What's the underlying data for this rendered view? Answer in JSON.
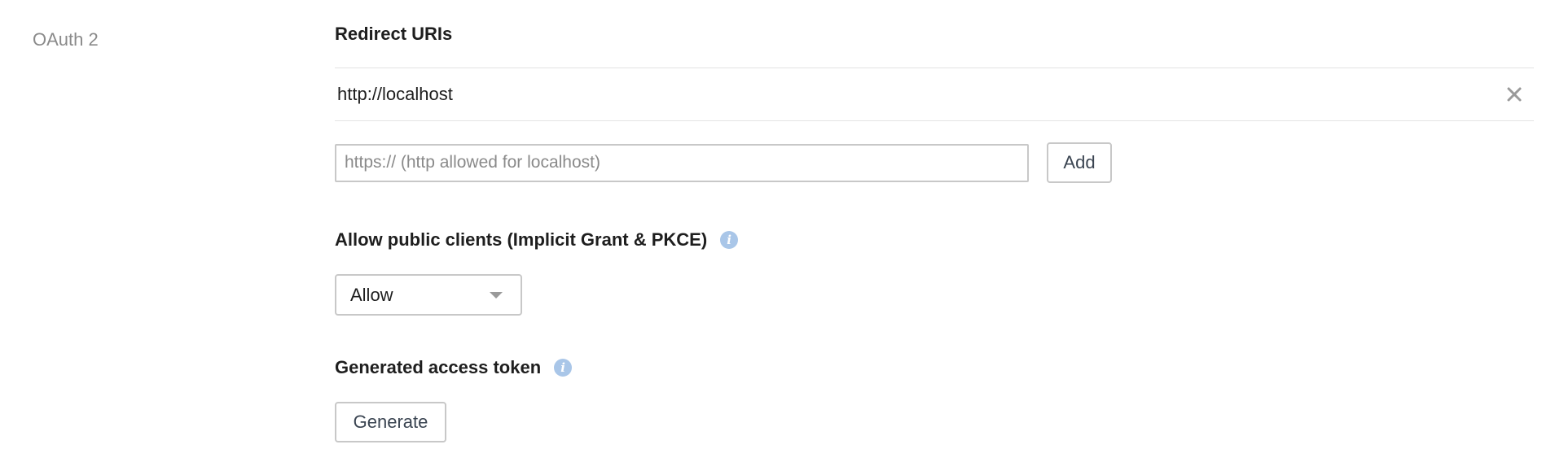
{
  "sidebar": {
    "section_label": "OAuth 2"
  },
  "redirect_uris": {
    "heading": "Redirect URIs",
    "items": [
      {
        "value": "http://localhost"
      }
    ],
    "input": {
      "placeholder": "https:// (http allowed for localhost)",
      "value": ""
    },
    "add_label": "Add"
  },
  "public_clients": {
    "heading": "Allow public clients (Implicit Grant & PKCE)",
    "info_icon": "info-icon",
    "select": {
      "selected": "Allow"
    }
  },
  "access_token": {
    "heading": "Generated access token",
    "info_icon": "info-icon",
    "generate_label": "Generate"
  },
  "colors": {
    "label_gray": "#8a8a8a",
    "border": "#c8c8c8",
    "info_blue": "#a9c6e8",
    "button_text": "#3a4451"
  }
}
